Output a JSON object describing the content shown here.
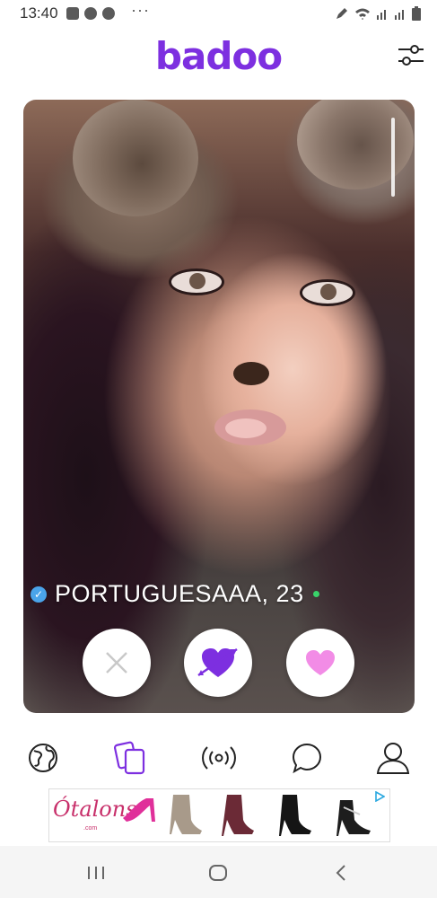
{
  "status_bar": {
    "time": "13:40",
    "more": "···"
  },
  "header": {
    "logo": "badoo"
  },
  "profile": {
    "name_age": "PORTUGUESAAA, 23",
    "verified": true,
    "online": true
  },
  "actions": {
    "pass": "pass",
    "crush": "crush",
    "like": "like"
  },
  "nav": [
    "people-nearby",
    "encounters",
    "live",
    "chats",
    "profile"
  ],
  "ad": {
    "brand": "Ótalons",
    "brand_sub": ".com"
  },
  "colors": {
    "brand": "#7d2fe0",
    "verified": "#4aa4ea",
    "online": "#39d36a",
    "heart": "#f28ce6"
  }
}
